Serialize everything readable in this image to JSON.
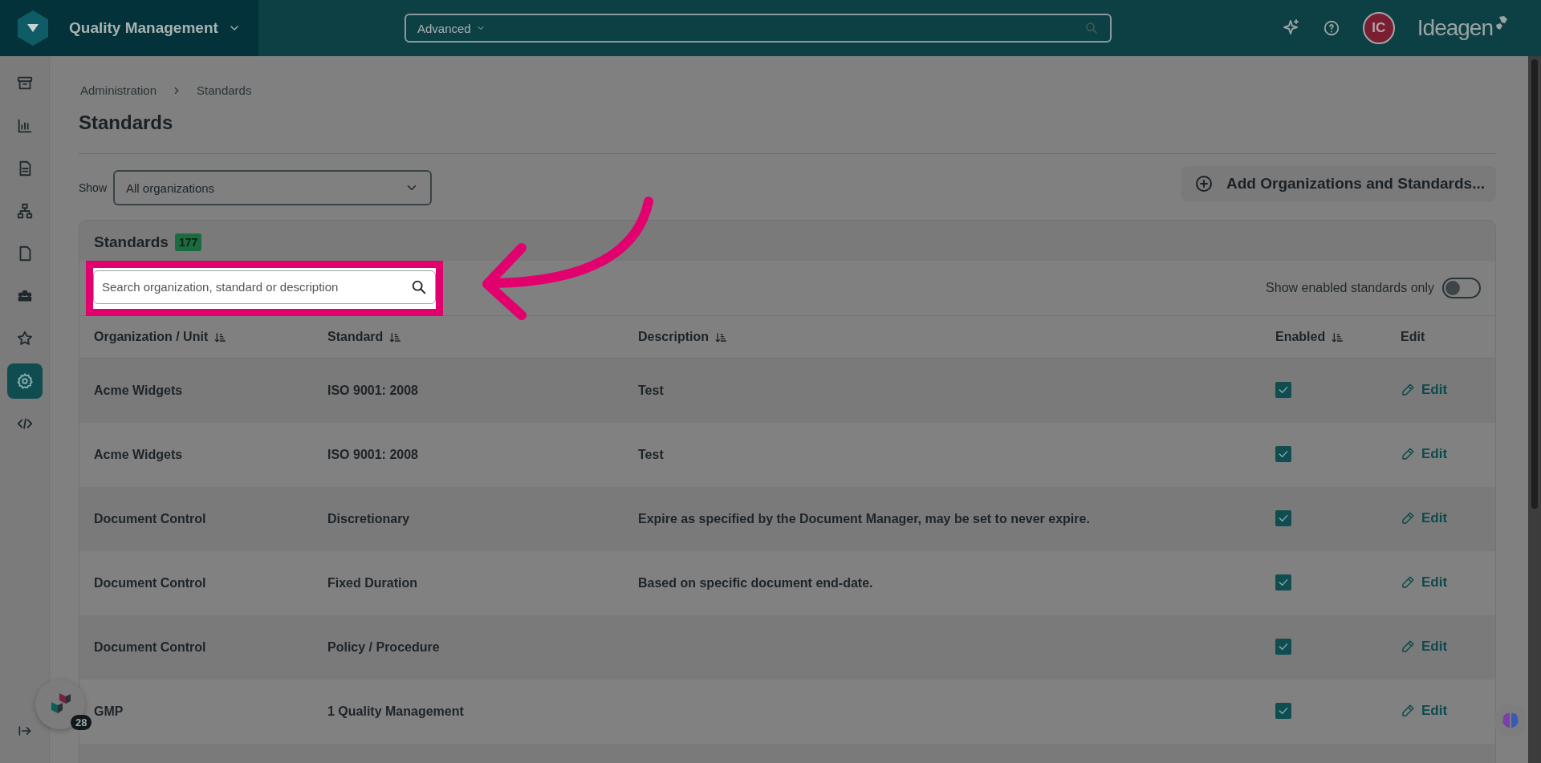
{
  "header": {
    "app_title": "Quality Management",
    "search_scope": "Advanced",
    "avatar": "IC",
    "brand": "Ideagen"
  },
  "sidebar": {
    "items": [
      {
        "selected": false
      },
      {
        "selected": false
      },
      {
        "selected": false
      },
      {
        "selected": false
      },
      {
        "selected": false
      },
      {
        "selected": false
      },
      {
        "selected": false
      },
      {
        "selected": true
      },
      {
        "selected": false
      }
    ]
  },
  "breadcrumb": [
    "Administration",
    "Standards"
  ],
  "title": "Standards",
  "filter": {
    "label": "Show",
    "value": "All organizations"
  },
  "add_button": "Add Organizations and Standards...",
  "card": {
    "title": "Standards",
    "count": "177",
    "search": {
      "placeholder": "Search organization, standard or description"
    },
    "toggle": {
      "label": "Show enabled standards only",
      "on": false
    },
    "columns": [
      {
        "label": "Organization / Unit",
        "sortable": true
      },
      {
        "label": "Standard",
        "sortable": true
      },
      {
        "label": "Description",
        "sortable": true
      },
      {
        "label": "Enabled",
        "sortable": true
      },
      {
        "label": "Edit",
        "sortable": false
      }
    ],
    "rows": [
      {
        "organization": "Acme Widgets",
        "standard": "ISO 9001: 2008",
        "description": "Test",
        "enabled": true,
        "edit": "Edit"
      },
      {
        "organization": "Acme Widgets",
        "standard": "ISO 9001: 2008",
        "description": "Test",
        "enabled": true,
        "edit": "Edit"
      },
      {
        "organization": "Document Control",
        "standard": "Discretionary",
        "description": "Expire as specified by the Document Manager, may be set to never expire.",
        "enabled": true,
        "edit": "Edit"
      },
      {
        "organization": "Document Control",
        "standard": "Fixed Duration",
        "description": "Based on specific document end-date.",
        "enabled": true,
        "edit": "Edit"
      },
      {
        "organization": "Document Control",
        "standard": "Policy / Procedure",
        "description": "",
        "enabled": true,
        "edit": "Edit"
      },
      {
        "organization": "GMP",
        "standard": "1 Quality Management",
        "description": "",
        "enabled": true,
        "edit": "Edit"
      }
    ]
  },
  "help_widget": {
    "badge": "28"
  }
}
